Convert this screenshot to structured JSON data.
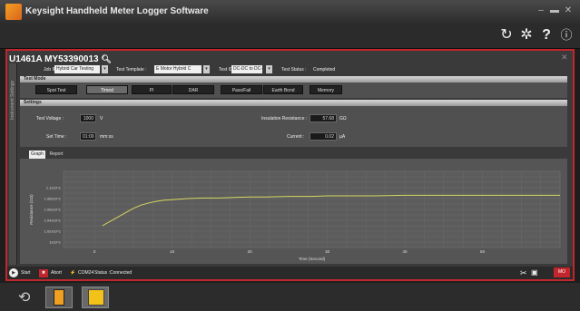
{
  "window": {
    "title": "Keysight Handheld Meter Logger Software"
  },
  "toolbar": {
    "refresh_icon": "refresh-icon",
    "settings_icon": "gear-icon",
    "help_icon": "help-icon",
    "info_icon": "info-icon"
  },
  "device": {
    "title": "U1461A  MY53390013"
  },
  "header": {
    "job_id_label": "Job ID :",
    "job_id_value": "Hybrid Car Testing",
    "template_label": "Test Template :",
    "template_value": "E Motor Hybrid C",
    "test_id_label": "Test ID :",
    "test_id_value": "DC-DC to DC-AC",
    "status_label": "Test Status :",
    "status_value": "Completed"
  },
  "side_tab": {
    "label": "Instrument Settings"
  },
  "test_mode": {
    "title": "Test Mode",
    "buttons": [
      "Spot Test",
      "Timed",
      "PI",
      "DAR",
      "Pass/Fail",
      "Earth Bond",
      "Memory"
    ],
    "active": "Timed"
  },
  "settings": {
    "title": "Settings",
    "voltage_label": "Test Voltage :",
    "voltage_value": "1000",
    "voltage_unit": "V",
    "time_label": "Set Time :",
    "time_value": "01:00",
    "time_unit": "mm:ss",
    "resistance_label": "Insulation Resistance :",
    "resistance_value": "57.68",
    "resistance_unit": "GΩ",
    "current_label": "Current :",
    "current_value": "0.02",
    "current_unit": "µA"
  },
  "tabs": {
    "graph": "Graph",
    "report": "Report"
  },
  "status": {
    "start": "Start",
    "abort": "Abort",
    "port": "COM24",
    "status_label": "Status :",
    "status_value": "Connected",
    "mo": "MO"
  },
  "chart_data": {
    "type": "line",
    "xlabel": "Time (Second)",
    "ylabel": "Resistance (GΩ)",
    "x_ticks": [
      0,
      10,
      20,
      30,
      40,
      50
    ],
    "y_ticks": [
      "1x10^1",
      "1.02x10^1",
      "1.04x10^1",
      "1.06x10^1",
      "1.08x10^1",
      "1.1x10^1"
    ],
    "xlim": [
      -4,
      60
    ],
    "series": [
      {
        "color": "#d8d860",
        "x": [
          1,
          2,
          3,
          4,
          5,
          6,
          7,
          8,
          9,
          10,
          12,
          14,
          16,
          18,
          20,
          22,
          25,
          28,
          30,
          33,
          36,
          40,
          44,
          48,
          52,
          56,
          60
        ],
        "y": [
          10.3,
          10.38,
          10.46,
          10.54,
          10.62,
          10.68,
          10.72,
          10.75,
          10.77,
          10.78,
          10.8,
          10.81,
          10.81,
          10.82,
          10.83,
          10.83,
          10.84,
          10.84,
          10.85,
          10.85,
          10.85,
          10.86,
          10.86,
          10.86,
          10.86,
          10.86,
          10.86
        ]
      }
    ],
    "ylim": [
      9.9,
      11.3
    ],
    "grid": true
  }
}
